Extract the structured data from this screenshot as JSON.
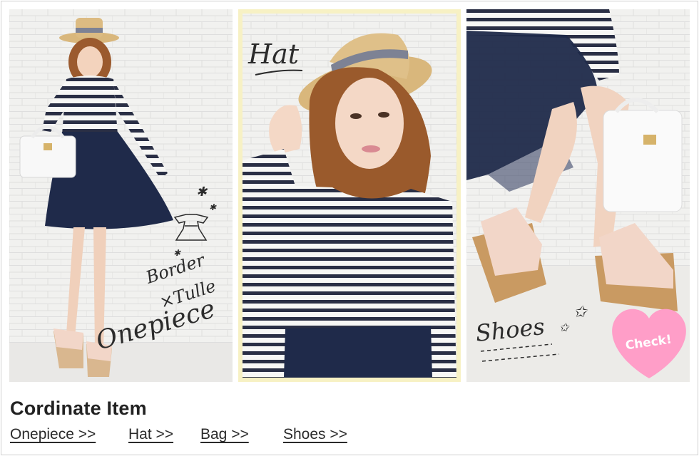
{
  "panels": [
    {
      "caption_lines": [
        "Border",
        "×Tulle",
        "Onepiece"
      ]
    },
    {
      "caption_lines": [
        "Hat"
      ]
    },
    {
      "caption_lines": [
        "Shoes"
      ],
      "badge": "Check!"
    }
  ],
  "section_title": "Cordinate Item",
  "links": [
    {
      "label": "Onepiece >>"
    },
    {
      "label": "Hat >>"
    },
    {
      "label": "Bag >>"
    },
    {
      "label": "Shoes >>"
    }
  ],
  "colors": {
    "badge_pink": "#ff9ec8",
    "highlight_frame": "#f7f1c4",
    "navy": "#1f2a4a",
    "stripe": "#2a2f45"
  }
}
